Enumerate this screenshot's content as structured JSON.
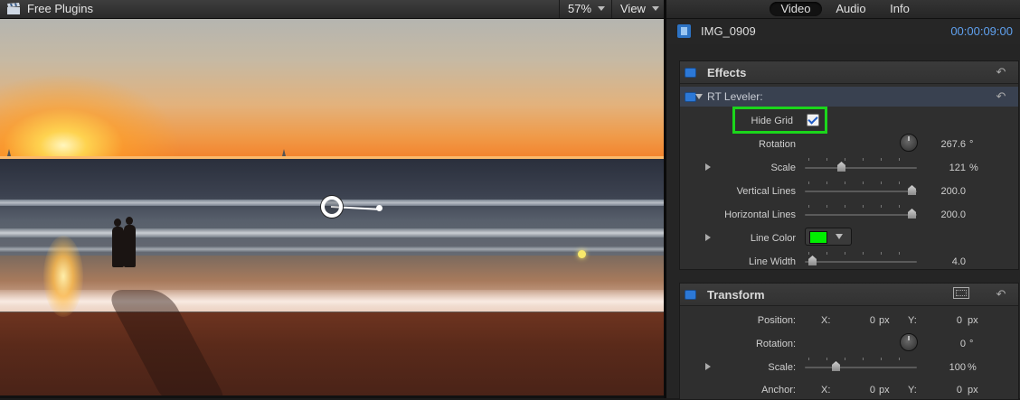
{
  "viewer": {
    "title": "Free Plugins",
    "zoom": "57%",
    "view_menu": "View"
  },
  "inspector": {
    "tabs": [
      "Video",
      "Audio",
      "Info"
    ],
    "active_tab": "Video",
    "clip_name": "IMG_0909",
    "timecode": "00:00:09:00",
    "effects": {
      "title": "Effects",
      "effect_name": "RT Leveler:",
      "hide_grid_label": "Hide Grid",
      "hide_grid_checked": true,
      "rotation_label": "Rotation",
      "rotation_value": "267.6",
      "rotation_unit": "°",
      "scale_label": "Scale",
      "scale_value": "121",
      "scale_unit": "%",
      "vertical_lines_label": "Vertical Lines",
      "vertical_lines_value": "200.0",
      "horizontal_lines_label": "Horizontal Lines",
      "horizontal_lines_value": "200.0",
      "line_color_label": "Line Color",
      "line_color": "#00ee00",
      "line_width_label": "Line Width",
      "line_width_value": "4.0"
    },
    "transform": {
      "title": "Transform",
      "position_label": "Position:",
      "x_label": "X:",
      "y_label": "Y:",
      "position_x": "0",
      "position_y": "0",
      "px_unit": "px",
      "rotation_label": "Rotation:",
      "rotation_value": "0",
      "rotation_unit": "°",
      "scale_label": "Scale:",
      "scale_value": "100",
      "scale_unit": "%",
      "anchor_label": "Anchor:",
      "anchor_x": "0",
      "anchor_y": "0"
    }
  },
  "colors": {
    "accent_blue": "#2c78d6",
    "timecode_blue": "#5fa0ee",
    "highlight_green": "#1bd61b"
  },
  "icons": {
    "clapper": "clapperboard-icon",
    "reset": "reset-arrow-icon",
    "transform_overlay": "transform-overlay-icon",
    "film": "film-icon"
  }
}
